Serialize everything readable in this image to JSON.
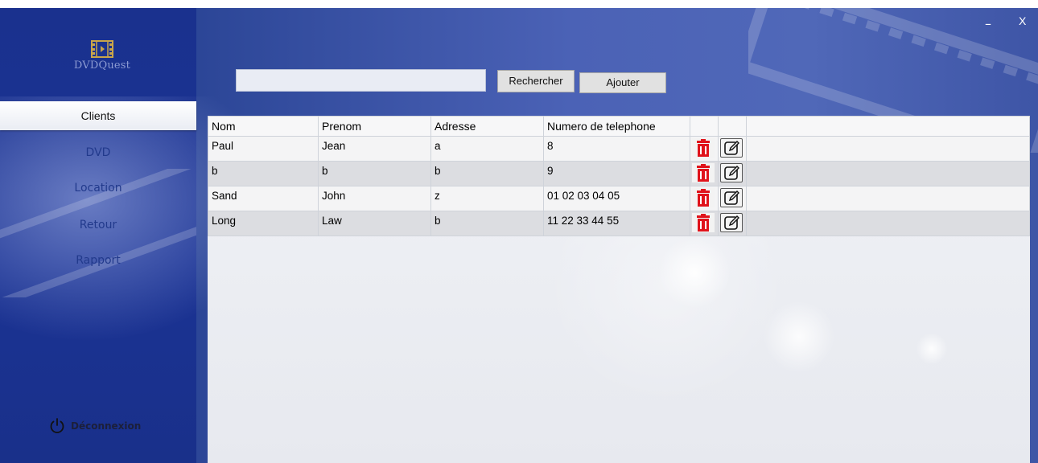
{
  "app": {
    "name": "DVDQuest"
  },
  "window": {
    "minimize_label": "–",
    "close_label": "X"
  },
  "sidebar": {
    "items": [
      {
        "label": "Clients",
        "active": true
      },
      {
        "label": "DVD",
        "active": false
      },
      {
        "label": "Location",
        "active": false
      },
      {
        "label": "Retour",
        "active": false
      },
      {
        "label": "Rapport",
        "active": false
      }
    ],
    "logout_label": "Déconnexion"
  },
  "search": {
    "value": "",
    "placeholder": ""
  },
  "toolbar": {
    "search_label": "Rechercher",
    "add_label": "Ajouter"
  },
  "table": {
    "columns": [
      "Nom",
      "Prenom",
      "Adresse",
      "Numero de telephone"
    ],
    "rows": [
      {
        "nom": "Paul",
        "prenom": "Jean",
        "adresse": "a",
        "telephone": "8"
      },
      {
        "nom": "b",
        "prenom": "b",
        "adresse": "b",
        "telephone": "9"
      },
      {
        "nom": "Sand",
        "prenom": "John",
        "adresse": "z",
        "telephone": "01 02 03 04 05"
      },
      {
        "nom": "Long",
        "prenom": "Law",
        "adresse": "b",
        "telephone": "11 22 33 44 55"
      }
    ],
    "row_actions": {
      "delete_icon": "trash-icon",
      "edit_icon": "edit-icon"
    }
  },
  "colors": {
    "sidebar": "#1a318e",
    "header": "#4b62b6",
    "delete": "#e0131b",
    "active_tab": "#ffffff"
  }
}
